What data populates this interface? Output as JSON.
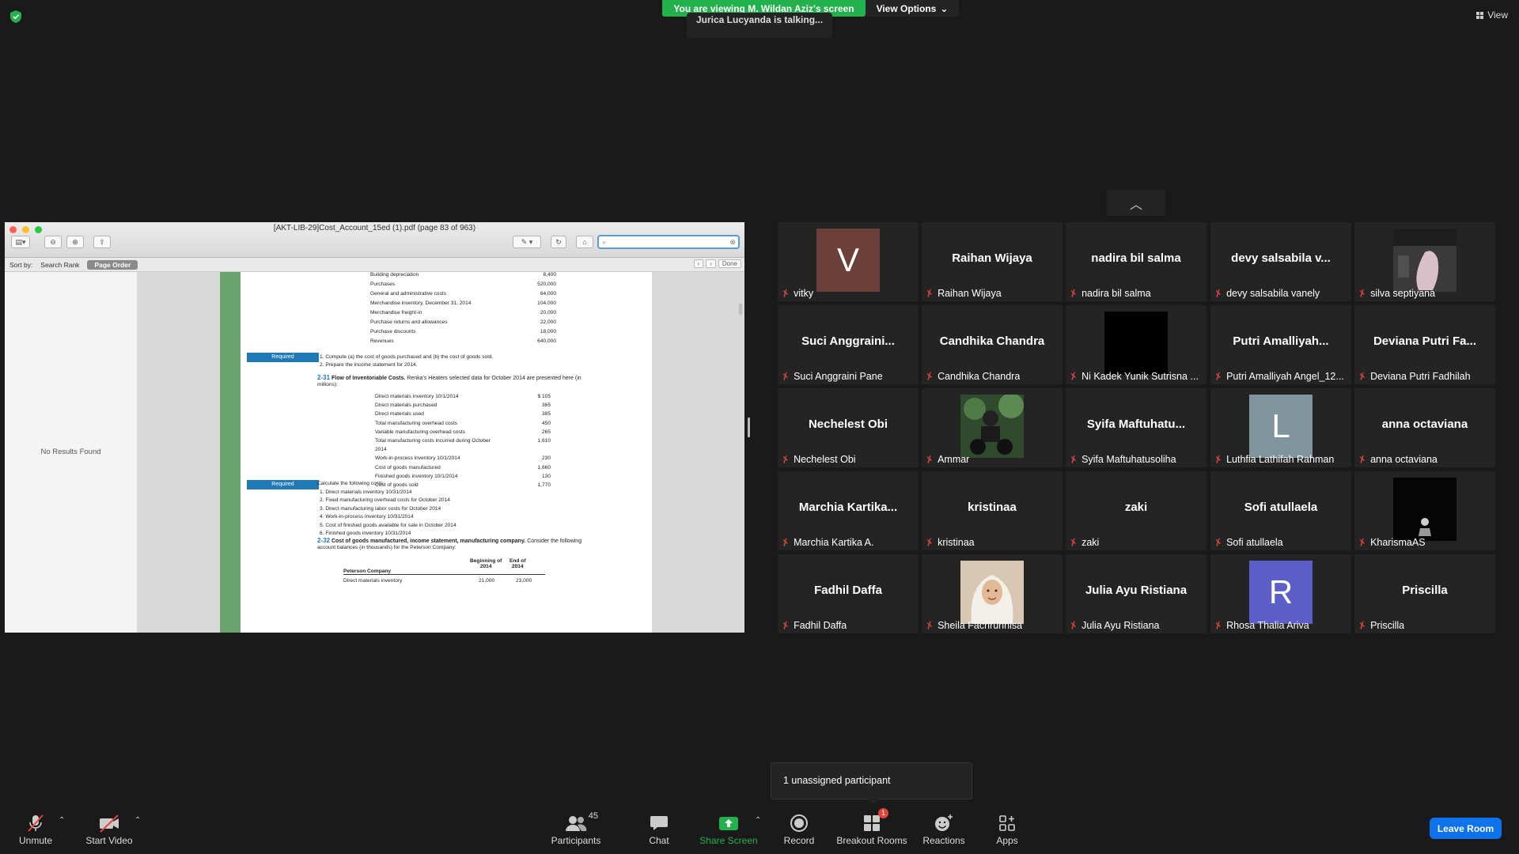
{
  "top": {
    "banner": "You are viewing M. Wildan Aziz's screen",
    "view_options": "View Options",
    "talking": "Jurica Lucyanda is talking...",
    "view_label": "View"
  },
  "shared": {
    "doc_title": "[AKT-LIB-29]Cost_Account_15ed (1).pdf (page 83 of 963)",
    "sort_by": "Sort by:",
    "sort_rank": "Search Rank",
    "sort_order": "Page Order",
    "done": "Done",
    "no_results": "No Results Found",
    "page": {
      "top_rows": [
        {
          "label": "Building depreciation",
          "value": "8,400"
        },
        {
          "label": "Purchases",
          "value": "520,000"
        },
        {
          "label": "General and administrative costs",
          "value": "64,000"
        },
        {
          "label": "Merchandise inventory, December 31, 2014",
          "value": "104,000"
        },
        {
          "label": "Merchandise freight-in",
          "value": "20,000"
        },
        {
          "label": "Purchase returns and allowances",
          "value": "22,000"
        },
        {
          "label": "Purchase discounts",
          "value": "18,000"
        },
        {
          "label": "Revenues",
          "value": "640,000"
        }
      ],
      "required": "Required",
      "req1_items": [
        "1.  Compute (a) the cost of goods purchased and (b) the cost of goods sold.",
        "2.  Prepare the income statement for 2014."
      ],
      "ex231_num": "2-31",
      "ex231_title": "Flow of Inventoriable Costs.",
      "ex231_text": "Renka's Heaters selected data for October 2014 are presented here (in",
      "ex231_text2": "millions):",
      "ex231_rows": [
        {
          "label": "Direct materials inventory 10/1/2014",
          "value": "$  105"
        },
        {
          "label": "Direct materials purchased",
          "value": "365"
        },
        {
          "label": "Direct materials used",
          "value": "385"
        },
        {
          "label": "Total manufacturing overhead costs",
          "value": "450"
        },
        {
          "label": "Variable manufacturing overhead costs",
          "value": "265"
        },
        {
          "label": "Total manufacturing costs incurred during October",
          "value": "1,610"
        },
        {
          "label": "2014",
          "value": ""
        },
        {
          "label": "Work-in-process inventory 10/1/2014",
          "value": "230"
        },
        {
          "label": "Cost of goods manufactured",
          "value": "1,660"
        },
        {
          "label": "Finished goods inventory 10/1/2014",
          "value": "130"
        },
        {
          "label": "Cost of goods sold",
          "value": "1,770"
        }
      ],
      "calc_text": "Calculate the following costs:",
      "req2_items": [
        "1.  Direct materials inventory 10/31/2014",
        "2.  Fixed manufacturing overhead costs for October 2014",
        "3.  Direct manufacturing labor costs for October 2014",
        "4.  Work-in-process inventory 10/31/2014",
        "5.  Cost of finished goods available for sale in October 2014",
        "6.  Finished goods inventory 10/31/2014"
      ],
      "ex232_num": "2-32",
      "ex232_title": "Cost of goods manufactured, income statement, manufacturing company.",
      "ex232_text": "Consider the following",
      "ex232_text2": "account balances (in thousands) for the Peterson Company:",
      "table_col1": "Beginning of",
      "table_col1b": "2014",
      "table_col2": "End of",
      "table_col2b": "2014",
      "table_company": "Peterson Company",
      "table_row_label": "Direct materials inventory",
      "table_row_v1": "21,000",
      "table_row_v2": "23,000"
    }
  },
  "tiles": [
    {
      "big": "",
      "avatar": "V",
      "avatar_color": "#6b4038",
      "name": "vitky"
    },
    {
      "big": "Raihan Wijaya",
      "name": "Raihan Wijaya"
    },
    {
      "big": "nadira bil salma",
      "name": "nadira bil salma"
    },
    {
      "big": "devy  salsabila  v...",
      "name": "devy salsabila vanely"
    },
    {
      "big": "",
      "photo": "dark-room",
      "name": "silva septiyana"
    },
    {
      "big": "Suci  Anggraini...",
      "name": "Suci Anggraini Pane"
    },
    {
      "big": "Candhika Chandra",
      "name": "Candhika Chandra"
    },
    {
      "big": "",
      "photo": "black",
      "name": "Ni Kadek Yunik Sutrisna ..."
    },
    {
      "big": "Putri  Amalliyah...",
      "name": "Putri Amalliyah Angel_12..."
    },
    {
      "big": "Deviana  Putri  Fa...",
      "name": "Deviana Putri Fadhilah"
    },
    {
      "big": "Nechelest Obi",
      "name": "Nechelest Obi"
    },
    {
      "big": "",
      "photo": "motorbike",
      "name": "Ammar"
    },
    {
      "big": "Syifa  Maftuhatu...",
      "name": "Syifa Maftuhatusoliha"
    },
    {
      "big": "",
      "avatar": "L",
      "avatar_color": "#7f949c",
      "name": "Luthfia Lathifah Rahman"
    },
    {
      "big": "anna octaviana",
      "name": "anna octaviana"
    },
    {
      "big": "Marchia  Kartika...",
      "name": "Marchia Kartika A."
    },
    {
      "big": "kristinaa",
      "name": "kristinaa"
    },
    {
      "big": "zaki",
      "name": "zaki"
    },
    {
      "big": "Sofi atullaela",
      "name": "Sofi atullaela"
    },
    {
      "big": "",
      "photo": "dark-figure",
      "name": "KharismaAS"
    },
    {
      "big": "Fadhil Daffa",
      "name": "Fadhil Daffa"
    },
    {
      "big": "",
      "photo": "hijab",
      "name": "Sheila Fachrunnisa"
    },
    {
      "big": "Julia Ayu Ristiana",
      "name": "Julia Ayu Ristiana"
    },
    {
      "big": "",
      "avatar": "R",
      "avatar_color": "#5b5fc7",
      "name": "Rhosa Thalia Ariva"
    },
    {
      "big": "Priscilla",
      "name": "Priscilla"
    }
  ],
  "popup": "1 unassigned participant",
  "toolbar": {
    "unmute": "Unmute",
    "start_video": "Start Video",
    "participants": "Participants",
    "participants_count": "45",
    "chat": "Chat",
    "share_screen": "Share Screen",
    "record": "Record",
    "breakout": "Breakout Rooms",
    "breakout_badge": "1",
    "reactions": "Reactions",
    "apps": "Apps",
    "leave": "Leave Room"
  },
  "colors": {
    "banner_green": "#23b14d",
    "leave_blue": "#0e72ed",
    "mic_off_red": "#e0453c",
    "required_blue": "#1f79b5"
  }
}
